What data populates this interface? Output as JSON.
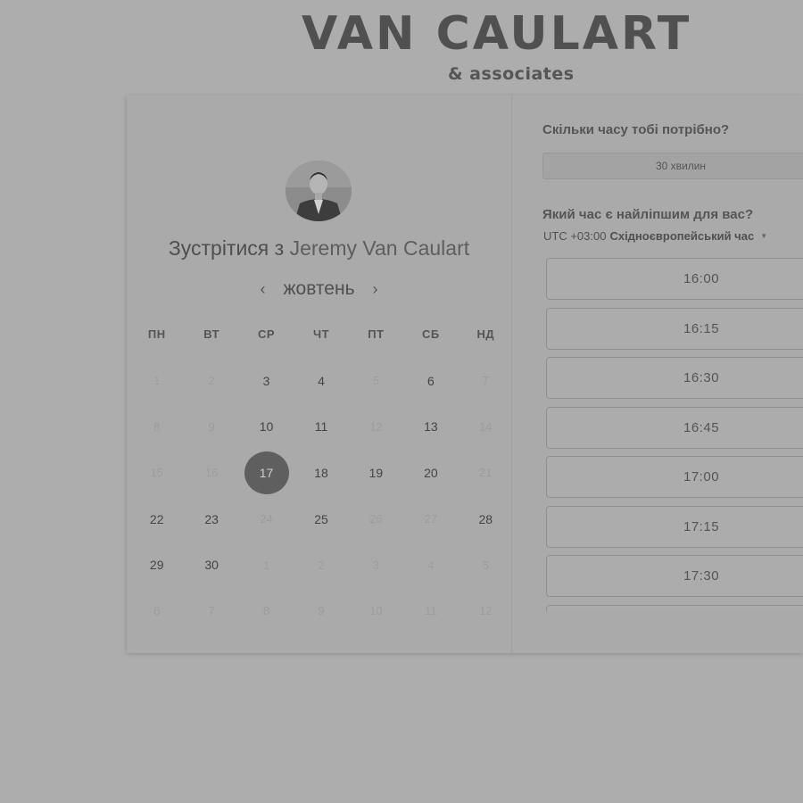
{
  "header": {
    "brand_title": "VAN CAULART",
    "brand_subtitle": "& associates"
  },
  "host": {
    "prefix": "Зустрітися з",
    "name": "Jeremy Van Caulart"
  },
  "calendar": {
    "month": "жовтень",
    "prev_icon": "chevron-left-icon",
    "next_icon": "chevron-right-icon",
    "weekdays": [
      "ПН",
      "ВТ",
      "СР",
      "ЧТ",
      "ПТ",
      "СБ",
      "НД"
    ],
    "days": [
      {
        "d": "1",
        "s": "muted"
      },
      {
        "d": "2",
        "s": "muted"
      },
      {
        "d": "3",
        "s": "active"
      },
      {
        "d": "4",
        "s": "active"
      },
      {
        "d": "5",
        "s": "muted"
      },
      {
        "d": "6",
        "s": "active"
      },
      {
        "d": "7",
        "s": "muted"
      },
      {
        "d": "8",
        "s": "muted"
      },
      {
        "d": "9",
        "s": "muted"
      },
      {
        "d": "10",
        "s": "active"
      },
      {
        "d": "11",
        "s": "active"
      },
      {
        "d": "12",
        "s": "muted"
      },
      {
        "d": "13",
        "s": "active"
      },
      {
        "d": "14",
        "s": "muted"
      },
      {
        "d": "15",
        "s": "muted"
      },
      {
        "d": "16",
        "s": "muted"
      },
      {
        "d": "17",
        "s": "selected"
      },
      {
        "d": "18",
        "s": "active"
      },
      {
        "d": "19",
        "s": "active"
      },
      {
        "d": "20",
        "s": "active"
      },
      {
        "d": "21",
        "s": "muted"
      },
      {
        "d": "22",
        "s": "active"
      },
      {
        "d": "23",
        "s": "active"
      },
      {
        "d": "24",
        "s": "muted"
      },
      {
        "d": "25",
        "s": "active"
      },
      {
        "d": "26",
        "s": "muted"
      },
      {
        "d": "27",
        "s": "muted"
      },
      {
        "d": "28",
        "s": "active"
      },
      {
        "d": "29",
        "s": "active"
      },
      {
        "d": "30",
        "s": "active"
      },
      {
        "d": "1",
        "s": "muted"
      },
      {
        "d": "2",
        "s": "muted"
      },
      {
        "d": "3",
        "s": "muted"
      },
      {
        "d": "4",
        "s": "muted"
      },
      {
        "d": "5",
        "s": "muted"
      },
      {
        "d": "6",
        "s": "muted"
      },
      {
        "d": "7",
        "s": "muted"
      },
      {
        "d": "8",
        "s": "muted"
      },
      {
        "d": "9",
        "s": "muted"
      },
      {
        "d": "10",
        "s": "muted"
      },
      {
        "d": "11",
        "s": "muted"
      },
      {
        "d": "12",
        "s": "muted"
      }
    ],
    "selected_day": "17"
  },
  "booking": {
    "duration_question": "Скільки часу тобі потрібно?",
    "duration_value": "30 хвилин",
    "time_question": "Який час є найліпшим для вас?",
    "timezone_offset": "UTC +03:00",
    "timezone_name": "Східноєвропейський час",
    "timezone_icon": "caret-down-icon",
    "slots": [
      "16:00",
      "16:15",
      "16:30",
      "16:45",
      "17:00",
      "17:15",
      "17:30",
      ""
    ]
  },
  "colors": {
    "background": "#adadad",
    "card": "#aaaaaa",
    "selected_day": "#5f5f5f"
  }
}
